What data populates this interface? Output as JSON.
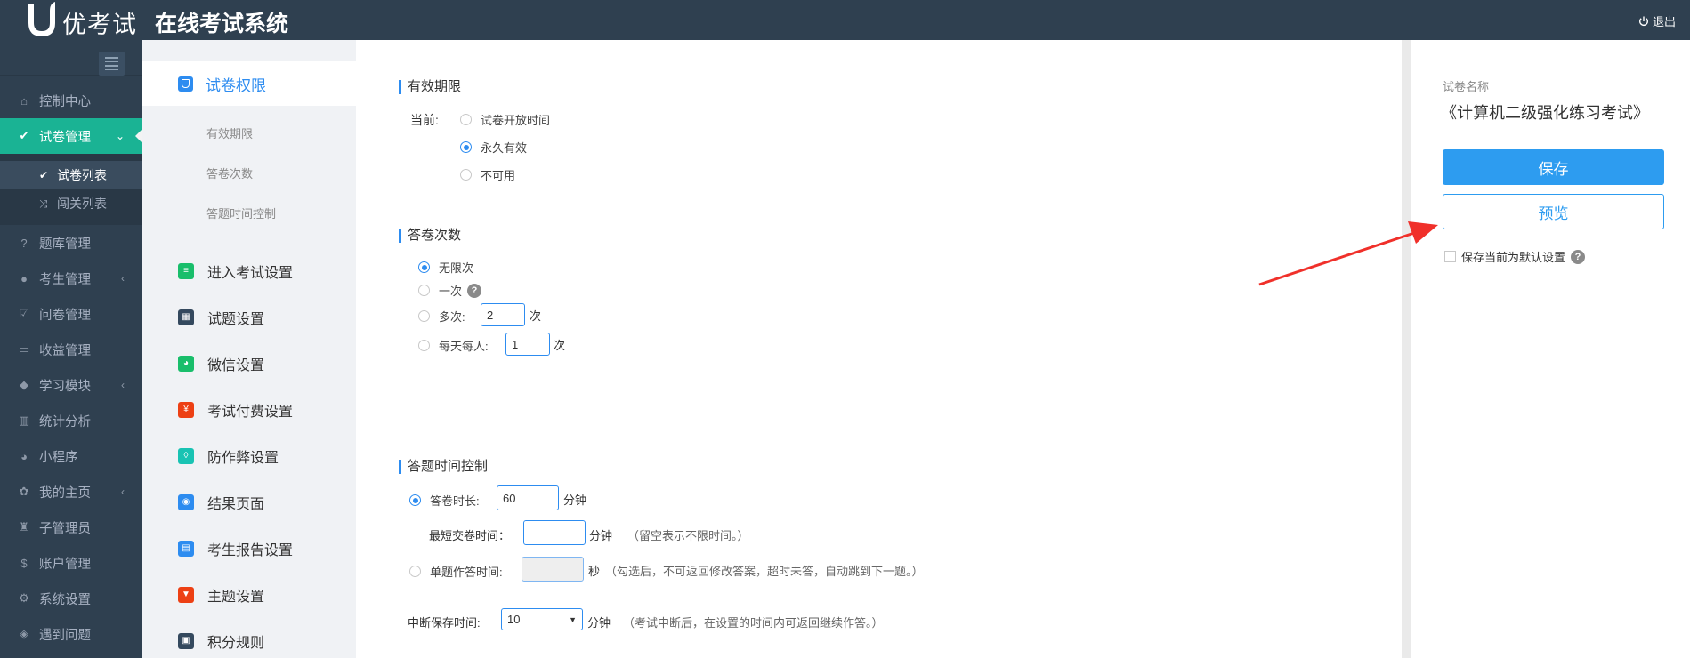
{
  "header": {
    "brand": "优考试",
    "title": "在线考试系统",
    "logout": "退出"
  },
  "sidebar": {
    "items": [
      {
        "label": "控制中心",
        "icon": "home-icon"
      },
      {
        "label": "试卷管理",
        "icon": "check-circle-icon",
        "active": true
      },
      {
        "label": "题库管理",
        "icon": "question-circle-icon"
      },
      {
        "label": "考生管理",
        "icon": "user-icon",
        "expandable": true
      },
      {
        "label": "问卷管理",
        "icon": "checkbox-icon"
      },
      {
        "label": "收益管理",
        "icon": "card-icon"
      },
      {
        "label": "学习模块",
        "icon": "graduation-cap-icon",
        "expandable": true
      },
      {
        "label": "统计分析",
        "icon": "bar-chart-icon"
      },
      {
        "label": "小程序",
        "icon": "wechat-icon"
      },
      {
        "label": "我的主页",
        "icon": "flower-icon",
        "expandable": true
      },
      {
        "label": "子管理员",
        "icon": "user-lock-icon"
      },
      {
        "label": "账户管理",
        "icon": "dollar-icon"
      },
      {
        "label": "系统设置",
        "icon": "gear-icon"
      },
      {
        "label": "遇到问题",
        "icon": "tag-icon"
      }
    ],
    "sub_items": [
      {
        "label": "试卷列表",
        "current": true
      },
      {
        "label": "闯关列表"
      }
    ]
  },
  "secnav": {
    "head": "试卷权限",
    "subs": [
      "有效期限",
      "答卷次数",
      "答题时间控制"
    ],
    "items": [
      {
        "label": "进入考试设置",
        "color": "#19be6b"
      },
      {
        "label": "试题设置",
        "color": "#34495e"
      },
      {
        "label": "微信设置",
        "color": "#19be6b"
      },
      {
        "label": "考试付费设置",
        "color": "#ed4014"
      },
      {
        "label": "防作弊设置",
        "color": "#19c3b3"
      },
      {
        "label": "结果页面",
        "color": "#2d8cf0"
      },
      {
        "label": "考生报告设置",
        "color": "#2d8cf0"
      },
      {
        "label": "主题设置",
        "color": "#ed4014"
      },
      {
        "label": "积分规则",
        "color": "#34495e"
      }
    ]
  },
  "validity": {
    "title": "有效期限",
    "current_label": "当前:",
    "options": [
      "试卷开放时间",
      "永久有效",
      "不可用"
    ],
    "selected": 1
  },
  "attempts": {
    "title": "答卷次数",
    "unlimited": "无限次",
    "once": "一次",
    "multi": "多次:",
    "multi_value": "2",
    "multi_unit": "次",
    "daily": "每天每人:",
    "daily_value": "1",
    "daily_unit": "次"
  },
  "timing": {
    "title": "答题时间控制",
    "duration_label": "答卷时长:",
    "duration_value": "60",
    "duration_unit": "分钟",
    "min_submit_label": "最短交卷时间：",
    "min_submit_value": "",
    "min_submit_unit": "分钟",
    "min_submit_hint": "（留空表示不限时间。）",
    "per_question_label": "单题作答时间:",
    "per_question_value": "",
    "per_question_unit": "秒",
    "per_question_hint": "（勾选后，不可返回修改答案，超时未答，自动跳到下一题。）",
    "interrupt_label": "中断保存时间:",
    "interrupt_value": "10",
    "interrupt_unit": "分钟",
    "interrupt_hint": "（考试中断后，在设置的时间内可返回继续作答。）"
  },
  "panel": {
    "paper_label": "试卷名称",
    "paper_name": "《计算机二级强化练习考试》",
    "save": "保存",
    "preview": "预览",
    "default_setting": "保存当前为默认设置"
  },
  "colors": {
    "accent": "#2d8cf0",
    "sidebar_bg": "#2f4050",
    "active_green": "#1ab394",
    "annotation_arrow": "#f0302a"
  }
}
